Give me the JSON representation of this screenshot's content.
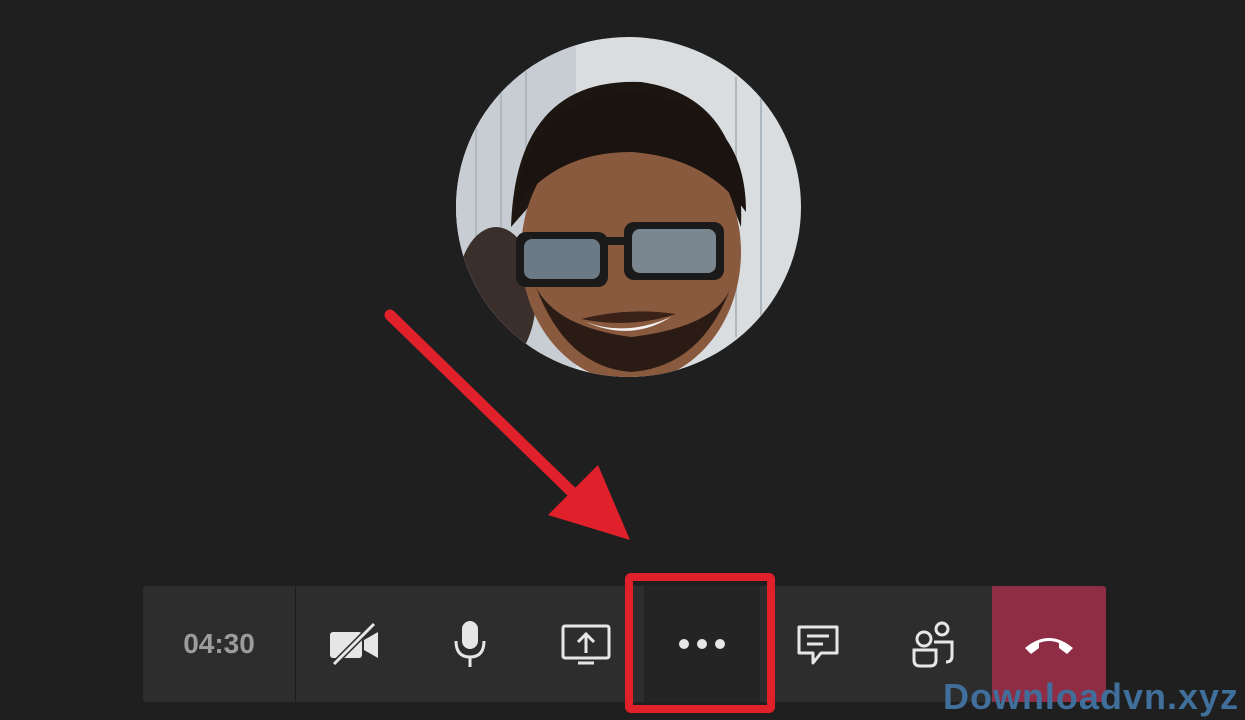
{
  "call": {
    "timer": "04:30"
  },
  "toolbar": {
    "buttons": [
      {
        "name": "camera-off-button",
        "icon": "camera-off-icon"
      },
      {
        "name": "microphone-button",
        "icon": "microphone-icon"
      },
      {
        "name": "share-screen-button",
        "icon": "share-screen-icon"
      },
      {
        "name": "more-actions-button",
        "icon": "ellipsis-icon"
      },
      {
        "name": "chat-button",
        "icon": "chat-icon"
      },
      {
        "name": "participants-button",
        "icon": "participants-icon"
      },
      {
        "name": "hang-up-button",
        "icon": "phone-hangup-icon"
      }
    ]
  },
  "colors": {
    "background": "#1f1f1f",
    "toolbar": "#2d2d2d",
    "hangup": "#8f2d45",
    "highlight": "#e0202a",
    "arrow": "#e0202a"
  },
  "watermark": {
    "text": "Downloadvn.xyz"
  }
}
